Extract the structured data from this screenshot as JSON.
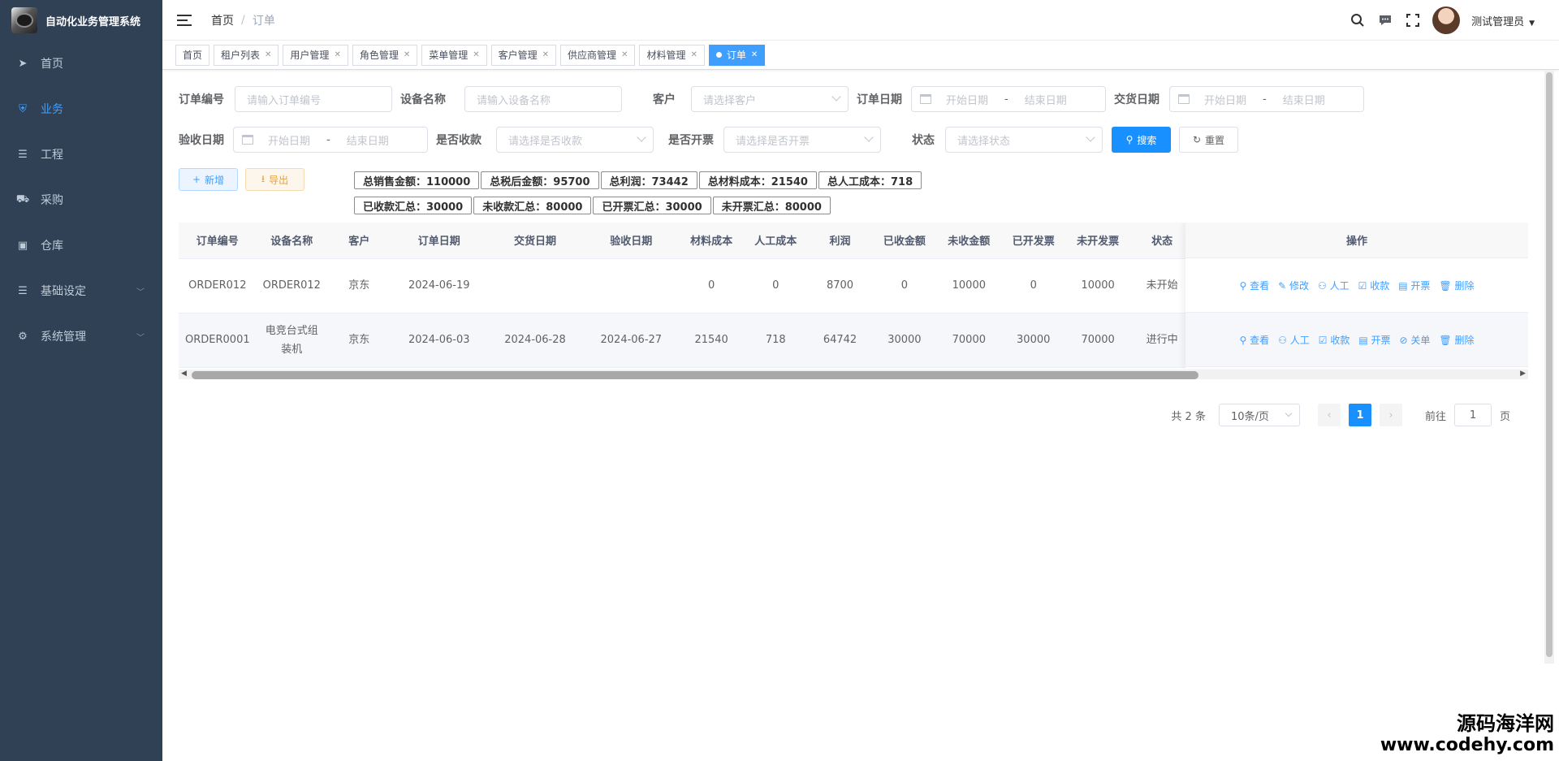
{
  "app": {
    "title": "自动化业务管理系统"
  },
  "sidebar": {
    "items": [
      {
        "label": "首页",
        "icon": "paper-plane-icon"
      },
      {
        "label": "业务",
        "icon": "shield-icon",
        "active": true
      },
      {
        "label": "工程",
        "icon": "sliders-icon"
      },
      {
        "label": "采购",
        "icon": "cart-icon"
      },
      {
        "label": "仓库",
        "icon": "box-icon"
      },
      {
        "label": "基础设定",
        "icon": "sliders-icon",
        "expandable": true
      },
      {
        "label": "系统管理",
        "icon": "gear-icon",
        "expandable": true
      }
    ]
  },
  "navbar": {
    "breadcrumb_home": "首页",
    "breadcrumb_sep": "/",
    "breadcrumb_current": "订单",
    "user": "测试管理员"
  },
  "tags": [
    {
      "label": "首页",
      "closable": false
    },
    {
      "label": "租户列表",
      "closable": true
    },
    {
      "label": "用户管理",
      "closable": true
    },
    {
      "label": "角色管理",
      "closable": true
    },
    {
      "label": "菜单管理",
      "closable": true
    },
    {
      "label": "客户管理",
      "closable": true
    },
    {
      "label": "供应商管理",
      "closable": true
    },
    {
      "label": "材料管理",
      "closable": true
    },
    {
      "label": "订单",
      "closable": true,
      "active": true
    }
  ],
  "search": {
    "order_no_label": "订单编号",
    "order_no_placeholder": "请输入订单编号",
    "device_label": "设备名称",
    "device_placeholder": "请输入设备名称",
    "customer_label": "客户",
    "customer_placeholder": "请选择客户",
    "order_date_label": "订单日期",
    "delivery_date_label": "交货日期",
    "accept_date_label": "验收日期",
    "received_label": "是否收款",
    "received_placeholder": "请选择是否收款",
    "invoiced_label": "是否开票",
    "invoiced_placeholder": "请选择是否开票",
    "status_label": "状态",
    "status_placeholder": "请选择状态",
    "start_placeholder": "开始日期",
    "range_sep": "-",
    "end_placeholder": "结束日期",
    "search_btn": "搜索",
    "reset_btn": "重置"
  },
  "toolbar": {
    "add_label": "新增",
    "export_label": "导出"
  },
  "summary": {
    "row1": [
      "总销售金额：110000",
      "总税后金额：95700",
      "总利润：73442",
      "总材料成本：21540",
      "总人工成本：718"
    ],
    "row2": [
      "已收款汇总：30000",
      "未收款汇总：80000",
      "已开票汇总：30000",
      "未开票汇总：80000"
    ]
  },
  "table": {
    "headers": [
      "订单编号",
      "设备名称",
      "客户",
      "订单日期",
      "交货日期",
      "验收日期",
      "材料成本",
      "人工成本",
      "利润",
      "已收金额",
      "未收金额",
      "已开发票",
      "未开发票",
      "状态"
    ],
    "ops_header": "操作",
    "rows": [
      {
        "cells": [
          "ORDER012",
          "ORDER012",
          "京东",
          "2024-06-19",
          "",
          "",
          "0",
          "0",
          "8700",
          "0",
          "10000",
          "0",
          "10000",
          "未开始"
        ],
        "ops": [
          "查看",
          "修改",
          "人工",
          "收款",
          "开票",
          "删除"
        ]
      },
      {
        "cells": [
          "ORDER0001",
          "电竞台式组装机",
          "京东",
          "2024-06-03",
          "2024-06-28",
          "2024-06-27",
          "21540",
          "718",
          "64742",
          "30000",
          "70000",
          "30000",
          "70000",
          "进行中"
        ],
        "ops": [
          "查看",
          "人工",
          "收款",
          "开票",
          "关单",
          "删除"
        ]
      }
    ]
  },
  "pagination": {
    "total": "共 2 条",
    "page_size": "10条/页",
    "current": "1",
    "goto_label": "前往",
    "goto_value": "1",
    "page_suffix": "页"
  },
  "watermark": {
    "line1": "源码海洋网",
    "line2": "www.codehy.com"
  },
  "colors": {
    "sidebar": "#304156",
    "accent": "#409eff",
    "primary": "#1890ff"
  }
}
